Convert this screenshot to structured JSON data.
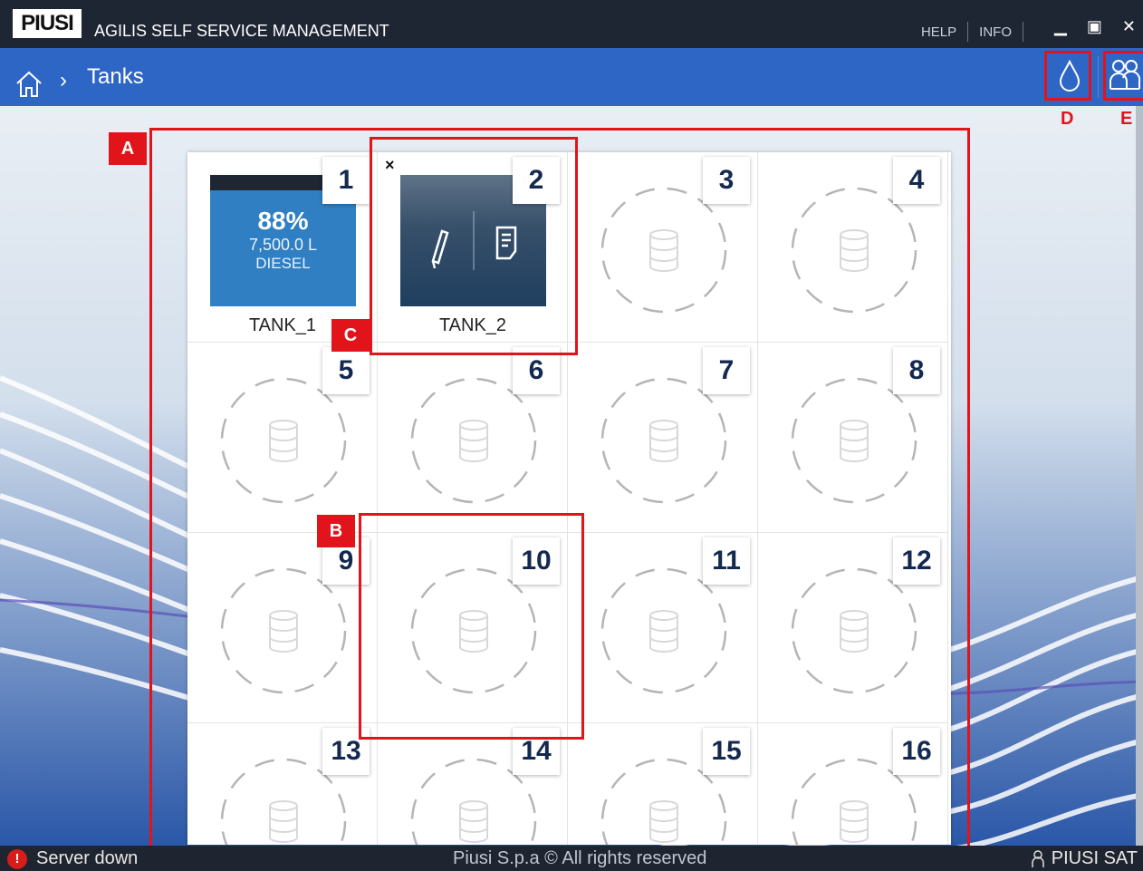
{
  "app": {
    "logo": "PIUSI",
    "title": "AGILIS SELF SERVICE MANAGEMENT",
    "menu": {
      "help": "HELP",
      "info": "INFO"
    }
  },
  "window_buttons": {
    "minimize": "▁",
    "maximize": "▣",
    "close": "✕"
  },
  "nav": {
    "breadcrumb": "Tanks",
    "separator": "›"
  },
  "tanks": [
    {
      "slot": "1",
      "name": "TANK_1",
      "percent": "88%",
      "volume": "7,500.0 L",
      "fuel": "DIESEL",
      "fill_level": 0.88
    },
    {
      "slot": "2",
      "name": "TANK_2",
      "close": "×"
    },
    {
      "slot": "3"
    },
    {
      "slot": "4"
    },
    {
      "slot": "5"
    },
    {
      "slot": "6"
    },
    {
      "slot": "7"
    },
    {
      "slot": "8"
    },
    {
      "slot": "9"
    },
    {
      "slot": "10"
    },
    {
      "slot": "11"
    },
    {
      "slot": "12"
    },
    {
      "slot": "13"
    },
    {
      "slot": "14"
    },
    {
      "slot": "15"
    },
    {
      "slot": "16"
    }
  ],
  "annotations": {
    "a": "A",
    "b": "B",
    "c": "C",
    "d": "D",
    "e": "E"
  },
  "status": {
    "message": "Server down",
    "copyright": "Piusi S.p.a © All rights reserved",
    "user": "PIUSI SAT"
  },
  "colors": {
    "accent": "#2e66c6",
    "annotation": "#e0141a",
    "tank_fill": "#2f7fc2",
    "header": "#1e2533"
  }
}
